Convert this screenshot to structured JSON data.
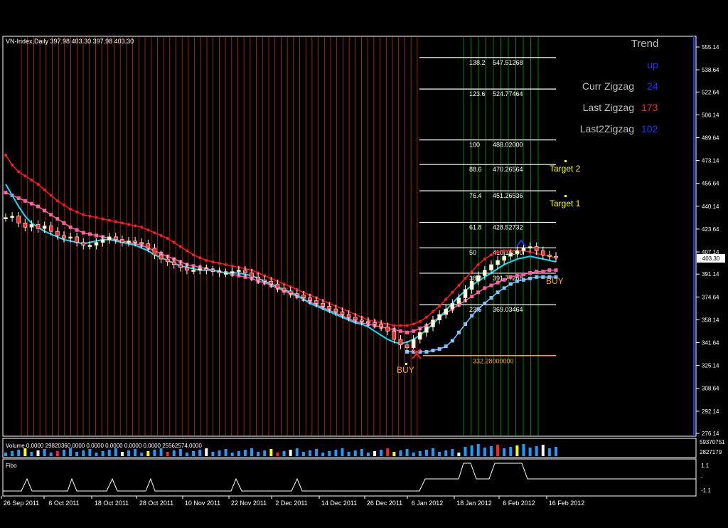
{
  "chart": {
    "symbol_line": "VN-Index,Daily  397.98 403.30 397.98 403.30",
    "price_label": "403.30",
    "colors": {
      "background": "#000000",
      "grid": "#FF4500",
      "grid_light": "#FFFFFF",
      "green_line": "#00CC00",
      "axis": "#FFFFFF",
      "ma_fast": "#00E5FF",
      "ma_red": "#FF1A1A",
      "ma_pink": "#FF5FA0",
      "ma_blue": "#4F7BFF",
      "ma_lightblue": "#7FC4FF",
      "candle_up": "#FFE05A",
      "candle_down": "#FF2A2A",
      "orange": "#FFA500"
    }
  },
  "trend_panel": {
    "title": "Trend",
    "trend_value": "up",
    "curr_zigzag_label": "Curr Zigzag",
    "curr_zigzag_value": "24",
    "last_zigzag_label": "Last Zigzag",
    "last_zigzag_value": "173",
    "last2_zigzag_label": "Last2Zigzag",
    "last2_zigzag_value": "102"
  },
  "fibo_levels": [
    {
      "pct": "138.2",
      "price": "547.51268",
      "value": 547.51
    },
    {
      "pct": "123.6",
      "price": "524.77464",
      "value": 524.77
    },
    {
      "pct": "100",
      "price": "488.02000",
      "value": 488.02
    },
    {
      "pct": "88.6",
      "price": "470.26564",
      "value": 470.27
    },
    {
      "pct": "76.4",
      "price": "451.26536",
      "value": 451.27
    },
    {
      "pct": "61.8",
      "price": "428.52732",
      "value": 428.53
    },
    {
      "pct": "50",
      "price": "410.15000",
      "value": 410.15
    },
    {
      "pct": "38.2",
      "price": "391.77268",
      "value": 391.77
    },
    {
      "pct": "23.6",
      "price": "369.03464",
      "value": 369.03
    }
  ],
  "base_level": {
    "price": "332.28000000",
    "value": 332.28
  },
  "annotations": {
    "target2": "Target 2",
    "target1": "Target 1",
    "buy1": "BUY",
    "buy2": "BUY"
  },
  "volume_panel": {
    "label": "Volume 0.0000 29820360.0000 0.0000 0.0000 0.0000 0.0000 25562574.0000",
    "axis_top": "59370751",
    "axis_bottom": "2827179"
  },
  "fibo_panel": {
    "label": "Fibo",
    "ticks": [
      "1.1",
      "-",
      "-1.1"
    ]
  },
  "chart_data": {
    "type": "candlestick",
    "title": "VN-Index,Daily",
    "y_ticks": [
      "555.14",
      "538.64",
      "522.64",
      "506.14",
      "489.64",
      "473.14",
      "456.64",
      "440.14",
      "423.64",
      "407.14",
      "391.14",
      "374.64",
      "358.14",
      "341.64",
      "325.14",
      "308.64",
      "292.14",
      "276.14"
    ],
    "ylim": [
      276.14,
      555.14
    ],
    "x_ticks": [
      "26 Sep 2011",
      "6 Oct 2011",
      "18 Oct 2011",
      "28 Oct 2011",
      "10 Nov 2011",
      "22 Nov 2011",
      "2 Dec 2011",
      "14 Dec 2011",
      "26 Dec 2011",
      "6 Jan 2012",
      "18 Jan 2012",
      "6 Feb 2012",
      "16 Feb 2012"
    ],
    "close_series": [
      432,
      433,
      428,
      425,
      427,
      424,
      426,
      422,
      419,
      417,
      418,
      414,
      412,
      412,
      414,
      416,
      418,
      416,
      414,
      415,
      414,
      413,
      410,
      405,
      402,
      400,
      398,
      396,
      394,
      394,
      395,
      394,
      393,
      392,
      392,
      393,
      394,
      392,
      389,
      387,
      386,
      384,
      381,
      379,
      377,
      376,
      374,
      372,
      370,
      368,
      366,
      364,
      362,
      360,
      358,
      357,
      356,
      355,
      353,
      350,
      344,
      340,
      338,
      344,
      349,
      353,
      358,
      362,
      366,
      370,
      374,
      380,
      386,
      390,
      394,
      398,
      401,
      404,
      406,
      408,
      410,
      411,
      408,
      405,
      404,
      403
    ],
    "ma_red_series": [
      477,
      470,
      465,
      462,
      459,
      456,
      452,
      448,
      444,
      441,
      438,
      436,
      434,
      433,
      432,
      431,
      430,
      429,
      428,
      427,
      426,
      425,
      423,
      421,
      419,
      417,
      414,
      411,
      408,
      405,
      403,
      401,
      400,
      399,
      398,
      397,
      396,
      395,
      394,
      392,
      390,
      388,
      386,
      384,
      382,
      380,
      378,
      376,
      374,
      372,
      370,
      368,
      366,
      364,
      362,
      360,
      358,
      357,
      356,
      355,
      354,
      354,
      354,
      355,
      357,
      360,
      364,
      368,
      373,
      378,
      383,
      388,
      393,
      398,
      402,
      405,
      407,
      408,
      408,
      408,
      408,
      407,
      406,
      405,
      404,
      403
    ],
    "ma_pink_series": [
      450,
      448,
      446,
      444,
      442,
      440,
      437,
      434,
      431,
      428,
      425,
      423,
      421,
      420,
      419,
      418,
      417,
      416,
      415,
      414,
      413,
      412,
      410,
      408,
      406,
      404,
      402,
      400,
      398,
      397,
      396,
      395,
      394,
      393,
      392,
      391,
      390,
      389,
      388,
      386,
      385,
      383,
      381,
      379,
      377,
      375,
      373,
      371,
      369,
      367,
      365,
      363,
      361,
      359,
      357,
      356,
      355,
      354,
      353,
      352,
      351,
      350,
      349,
      350,
      352,
      354,
      357,
      360,
      363,
      366,
      369,
      372,
      375,
      378,
      381,
      383,
      385,
      387,
      389,
      390,
      391,
      392,
      393,
      393,
      394,
      394
    ],
    "ma_cyan_series": [
      456,
      448,
      440,
      433,
      428,
      425,
      422,
      420,
      418,
      416,
      415,
      414,
      413,
      414,
      415,
      416,
      416,
      415,
      414,
      413,
      412,
      410,
      408,
      405,
      403,
      401,
      399,
      397,
      396,
      395,
      394,
      394,
      394,
      393,
      392,
      392,
      392,
      391,
      390,
      388,
      386,
      384,
      382,
      380,
      378,
      376,
      373,
      370,
      368,
      366,
      364,
      362,
      360,
      358,
      356,
      355,
      353,
      350,
      347,
      344,
      342,
      341,
      342,
      344,
      347,
      351,
      355,
      360,
      365,
      370,
      375,
      379,
      383,
      386,
      389,
      392,
      395,
      398,
      400,
      402,
      403,
      404,
      403,
      402,
      401,
      400
    ],
    "trend_blue_series": [
      null,
      null,
      null,
      null,
      null,
      null,
      null,
      null,
      null,
      null,
      null,
      null,
      null,
      null,
      null,
      null,
      null,
      null,
      null,
      null,
      null,
      null,
      null,
      null,
      null,
      null,
      null,
      null,
      null,
      null,
      null,
      null,
      null,
      null,
      null,
      null,
      null,
      null,
      null,
      null,
      null,
      null,
      null,
      null,
      null,
      null,
      null,
      null,
      null,
      null,
      null,
      null,
      null,
      null,
      null,
      null,
      null,
      null,
      null,
      null,
      null,
      null,
      335,
      335,
      335,
      335,
      336,
      337,
      339,
      343,
      349,
      355,
      361,
      366,
      370,
      374,
      378,
      381,
      384,
      386,
      387,
      388,
      389,
      389,
      389,
      389
    ]
  }
}
